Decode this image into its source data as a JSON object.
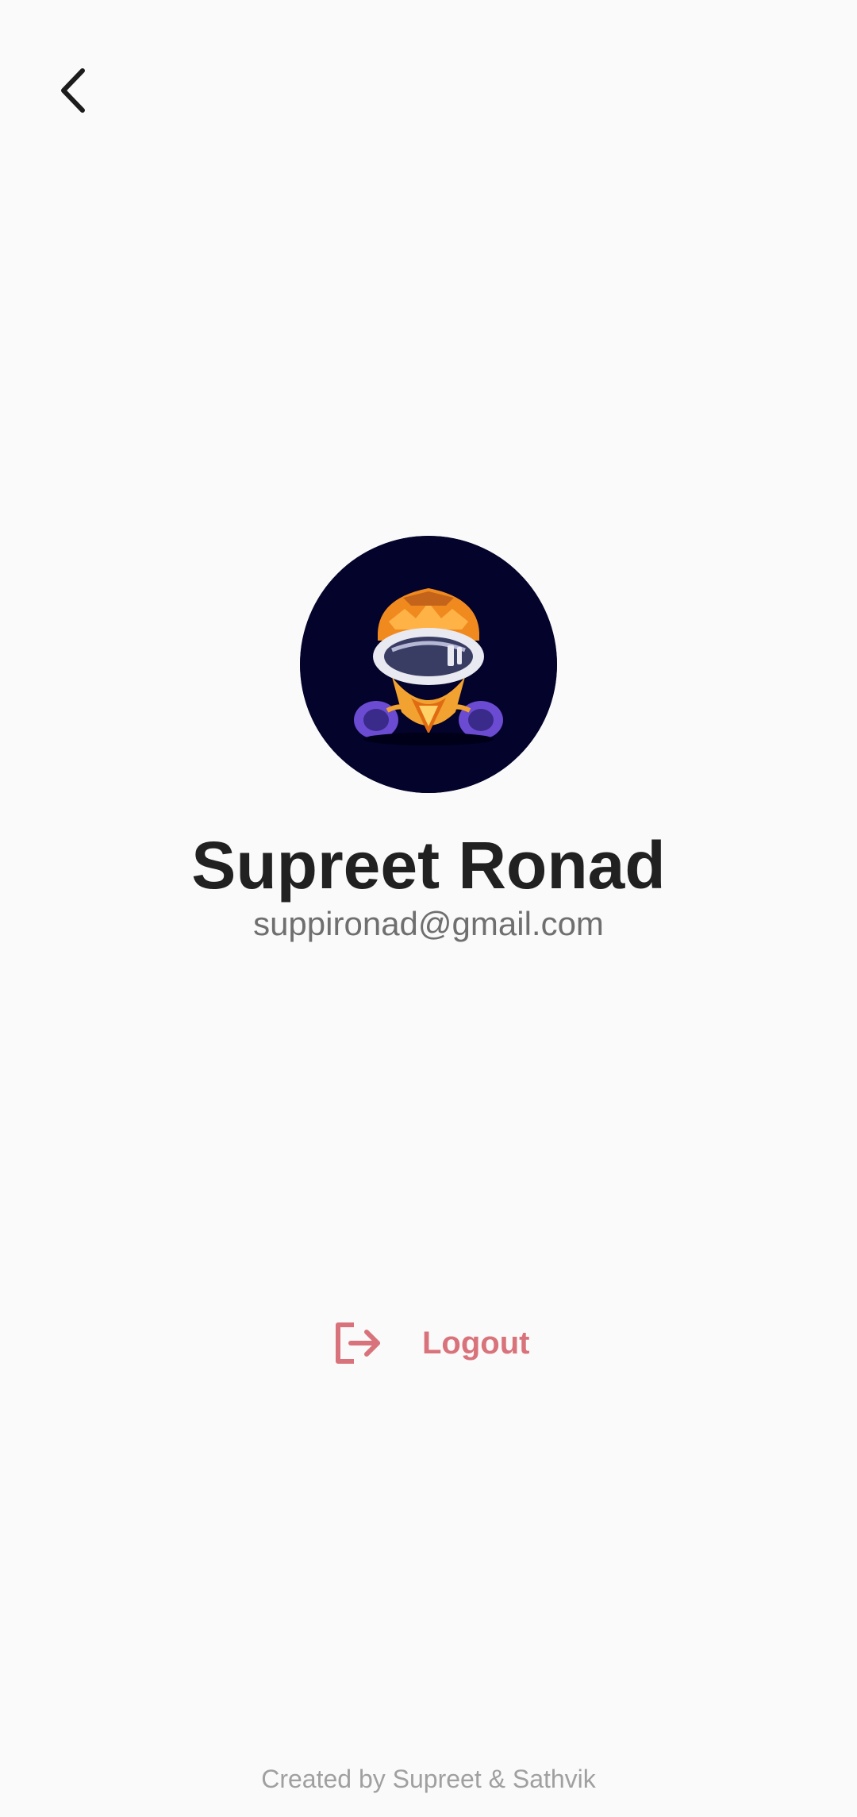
{
  "header": {
    "back_icon": "chevron-left-icon"
  },
  "profile": {
    "avatar_icon": "gas-mask-helmet-avatar",
    "name": "Supreet Ronad",
    "email": "suppironad@gmail.com"
  },
  "actions": {
    "logout_label": "Logout",
    "logout_icon": "logout-icon",
    "logout_color": "#d9737b"
  },
  "footer": {
    "credit": "Created by Supreet & Sathvik"
  },
  "colors": {
    "background": "#fafafa",
    "avatar_background": "#03032b",
    "name": "#212121",
    "email": "#6f6f6f",
    "footer": "#a0a0a0"
  }
}
